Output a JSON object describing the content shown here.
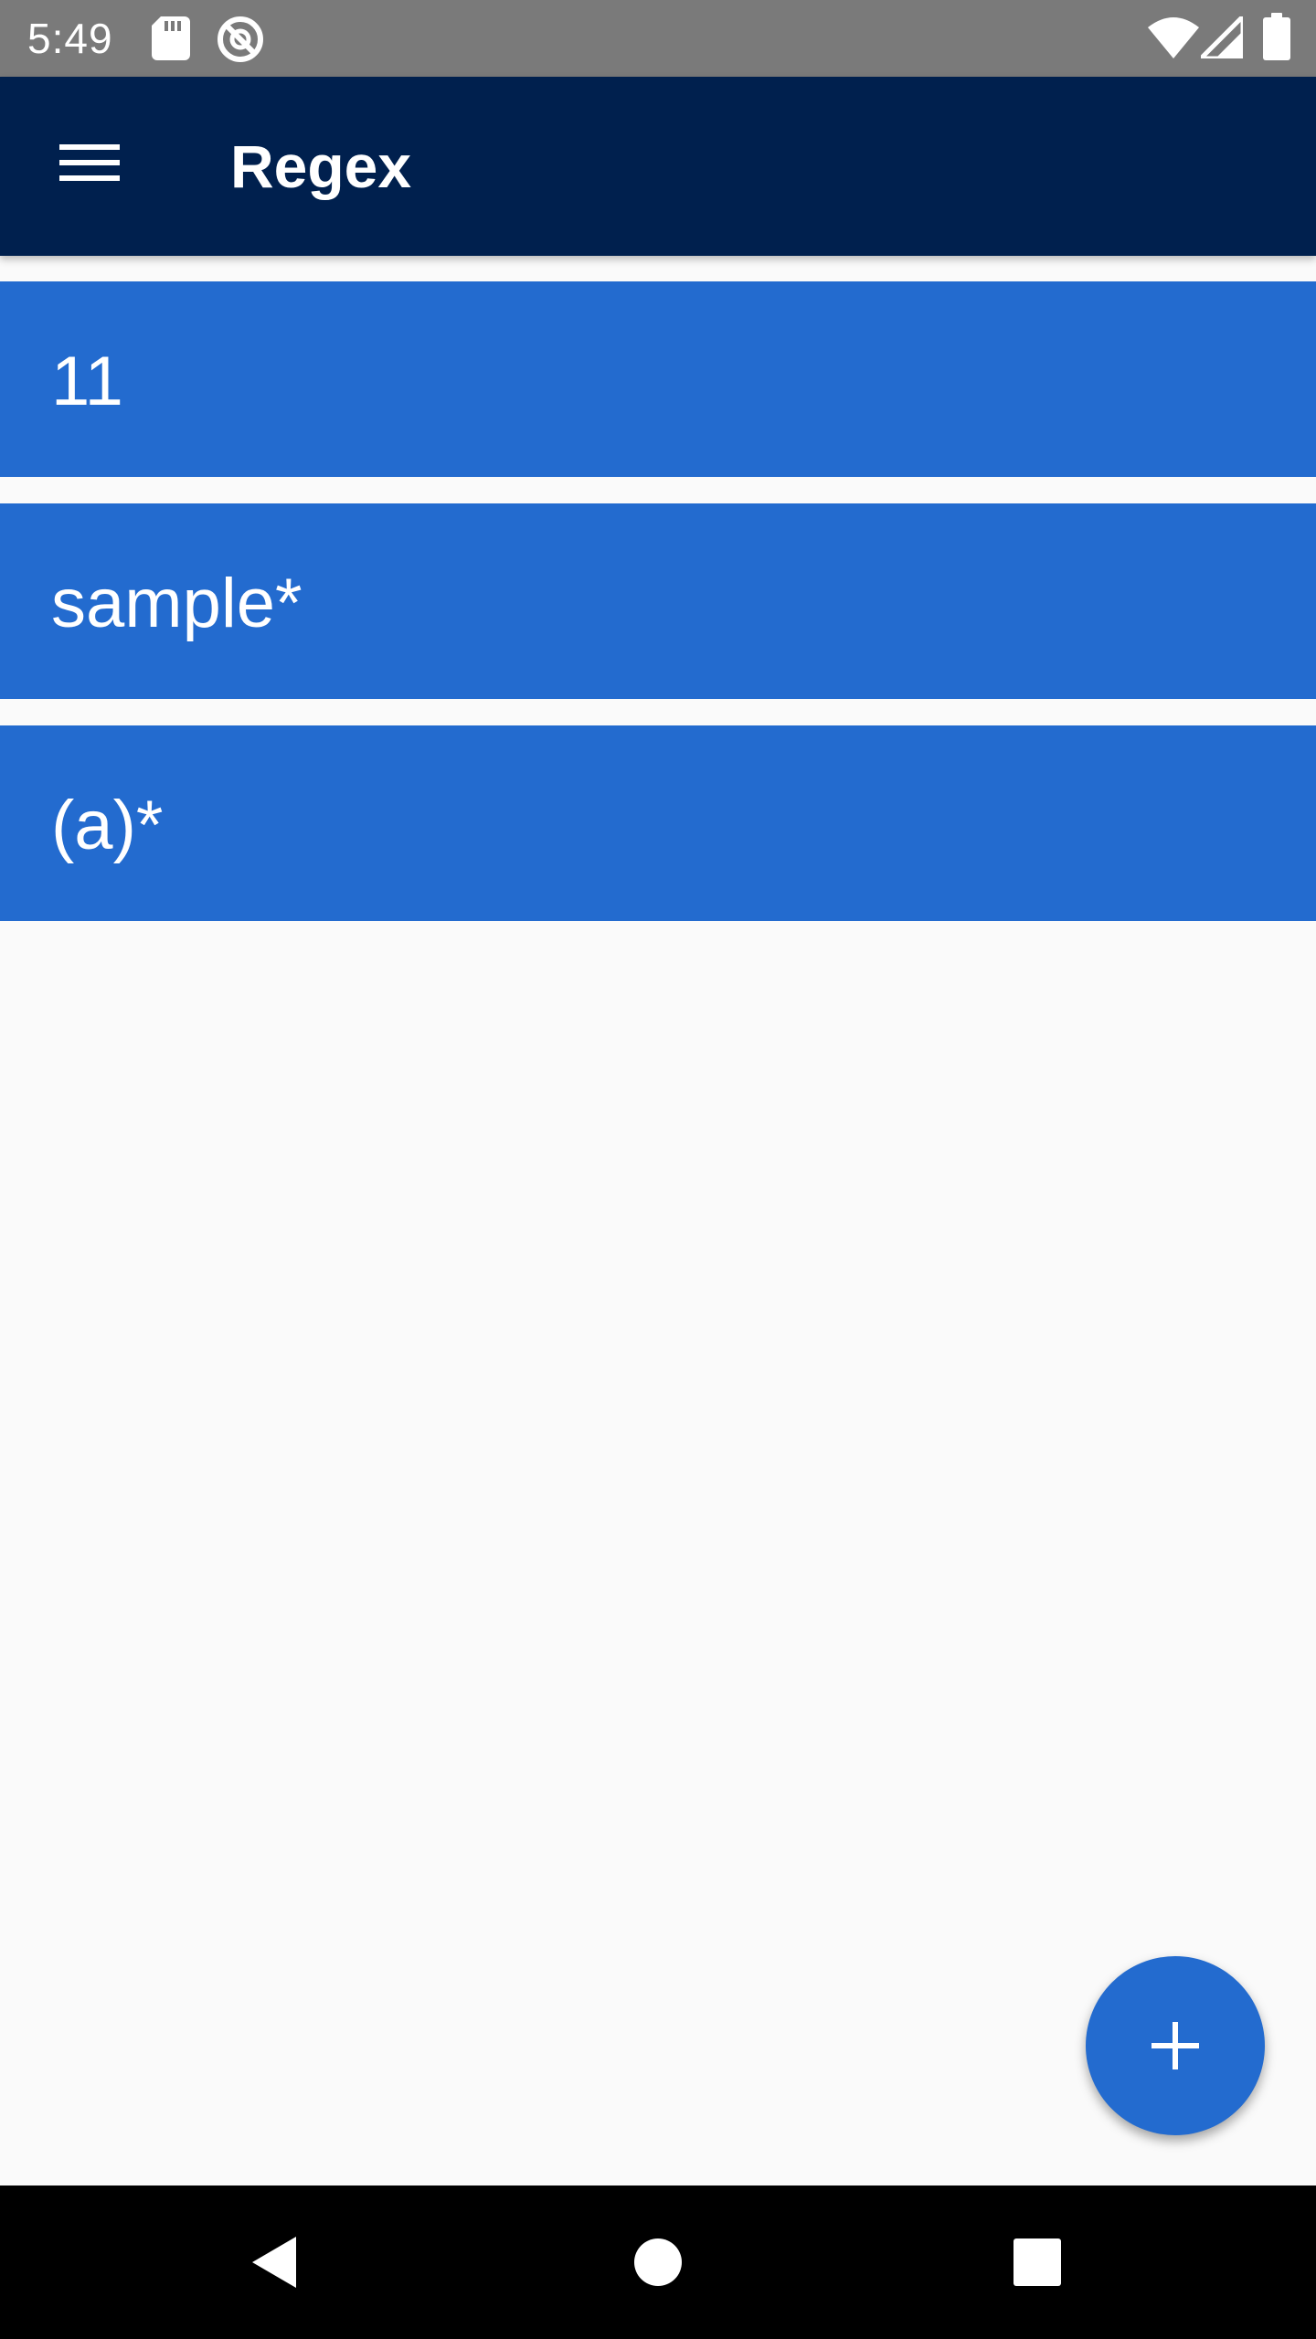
{
  "status_bar": {
    "time": "5:49",
    "icons": [
      "sd-card-icon",
      "sync-icon",
      "wifi-icon",
      "signal-icon",
      "battery-icon"
    ]
  },
  "app_bar": {
    "menu_icon": "hamburger-menu-icon",
    "title": "Regex"
  },
  "regex_list": {
    "items": [
      {
        "label": "11"
      },
      {
        "label": "sample*"
      },
      {
        "label": "(a)*"
      }
    ]
  },
  "fab": {
    "icon": "plus-icon"
  },
  "nav_bar": {
    "icons": [
      "back-icon",
      "home-icon",
      "recents-icon"
    ]
  },
  "colors": {
    "status_bar": "#7a7a7a",
    "app_bar": "#00204e",
    "accent": "#236bcf",
    "background": "#fafafa",
    "nav_bar": "#000000"
  }
}
